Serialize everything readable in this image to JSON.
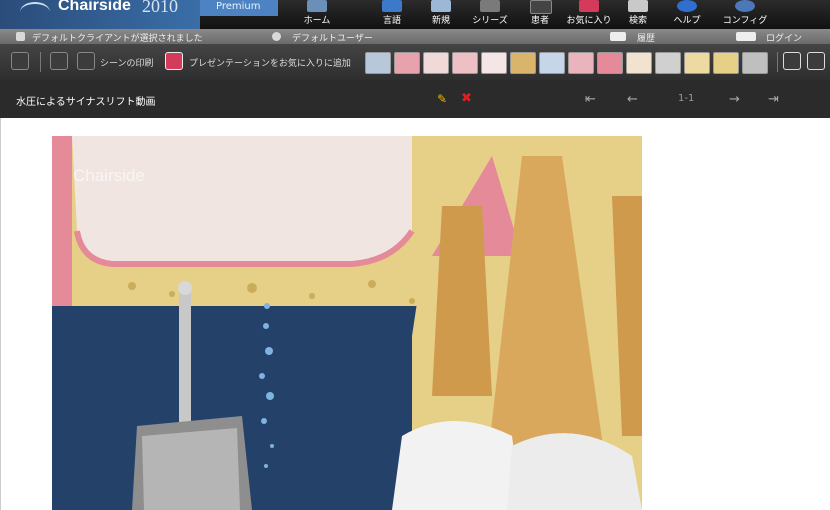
{
  "app": {
    "name": "Chairside",
    "year": "2010",
    "edition": "Premium"
  },
  "nav": [
    {
      "label": "ホーム",
      "icon": "home-icon"
    },
    {
      "label": "言語",
      "icon": "language-icon"
    },
    {
      "label": "新規",
      "icon": "new-icon"
    },
    {
      "label": "シリーズ",
      "icon": "series-icon"
    },
    {
      "label": "患者",
      "icon": "patient-icon"
    },
    {
      "label": "お気に入り",
      "icon": "favorites-icon"
    },
    {
      "label": "検索",
      "icon": "search-icon"
    },
    {
      "label": "ヘルプ",
      "icon": "help-icon"
    },
    {
      "label": "コンフィグ",
      "icon": "config-icon"
    }
  ],
  "status": {
    "client": "デフォルトクライアントが選択されました",
    "user": "デフォルトユーザー",
    "history": "履歴",
    "login": "ログイン"
  },
  "toolbar": {
    "print_label": "シーンの印刷",
    "favorite_label": "プレゼンテーションをお気に入りに追加"
  },
  "scene": {
    "title": "水圧によるサイナスリフト動画",
    "pager": "1-1",
    "watermark": "Chairside"
  },
  "colors": {
    "header_bg": "#1c1c1c",
    "brand_blue": "#3a6ea8",
    "media_bg": "#24416a",
    "bone": "#e6cf86",
    "gum": "#e58a98",
    "edit_icon": "#f0b800",
    "delete_icon": "#e02020"
  }
}
